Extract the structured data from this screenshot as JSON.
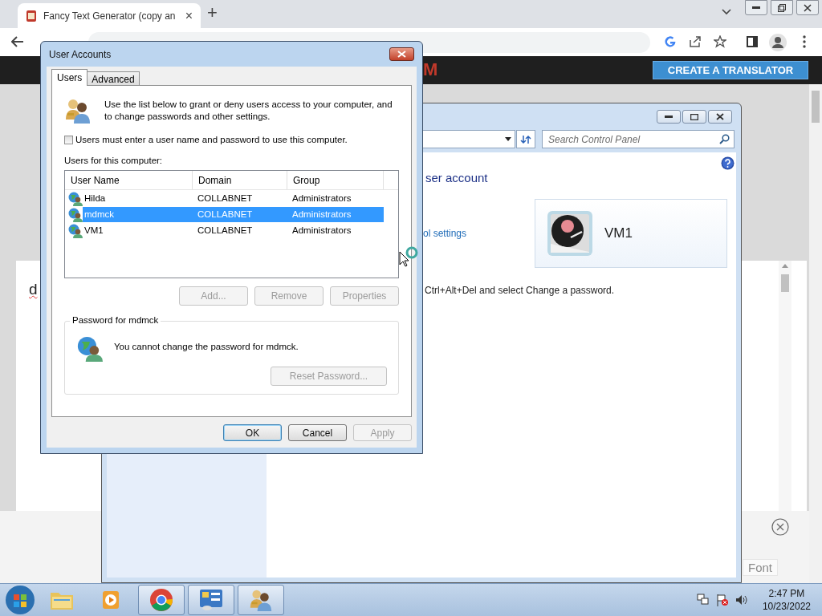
{
  "browser": {
    "tab": {
      "title": "Fancy Text Generator (copy an",
      "close": "×"
    },
    "new_tab": "+"
  },
  "page": {
    "header_logo": "M",
    "cta": "CREATE A TRANSLATOR",
    "card_text": "d",
    "font_button": "Font"
  },
  "control_panel": {
    "search": {
      "placeholder": "Search Control Panel"
    },
    "heading": "ser account",
    "link": "ol settings",
    "account": {
      "name": "VM1"
    },
    "note": "Ctrl+Alt+Del and select Change a password."
  },
  "dialog": {
    "title": "User Accounts",
    "tabs": [
      {
        "label": "Users",
        "selected": true
      },
      {
        "label": "Advanced",
        "selected": false
      }
    ],
    "intro": "Use the list below to grant or deny users access to your computer, and to change passwords and other settings.",
    "require_login": {
      "label": "Users must enter a user name and password to use this computer.",
      "checked": false
    },
    "list_label": "Users for this computer:",
    "columns": [
      "User Name",
      "Domain",
      "Group"
    ],
    "rows": [
      {
        "cells": [
          "Hilda",
          "COLLABNET",
          "Administrators"
        ],
        "selected": false
      },
      {
        "cells": [
          "mdmck",
          "COLLABNET",
          "Administrators"
        ],
        "selected": true
      },
      {
        "cells": [
          "VM1",
          "COLLABNET",
          "Administrators"
        ],
        "selected": false
      }
    ],
    "list_buttons": [
      {
        "label": "Add...",
        "disabled": true
      },
      {
        "label": "Remove",
        "disabled": true
      },
      {
        "label": "Properties",
        "disabled": true
      }
    ],
    "password_group": {
      "title": "Password for mdmck",
      "message": "You cannot change the password for mdmck.",
      "button": {
        "label": "Reset Password...",
        "disabled": true
      }
    },
    "buttons": [
      {
        "label": "OK",
        "disabled": false,
        "default": true
      },
      {
        "label": "Cancel",
        "disabled": false,
        "default": false
      },
      {
        "label": "Apply",
        "disabled": true,
        "default": false
      }
    ]
  },
  "taskbar": {
    "items": [
      {
        "kind": "folder",
        "running": false
      },
      {
        "kind": "media",
        "running": false
      },
      {
        "kind": "chrome",
        "running": true
      },
      {
        "kind": "control-panel",
        "running": true
      },
      {
        "kind": "users",
        "running": true
      }
    ],
    "time": "2:47 PM",
    "date": "10/23/2022"
  }
}
